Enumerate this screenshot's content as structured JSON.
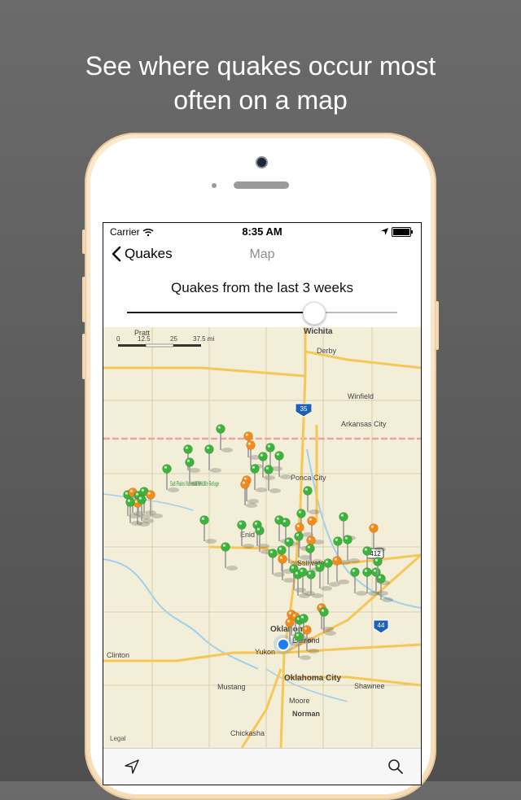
{
  "promo": {
    "headline_line1": "See where quakes occur most",
    "headline_line2": "often on a map"
  },
  "status_bar": {
    "carrier": "Carrier",
    "time": "8:35 AM"
  },
  "nav": {
    "back_label": "Quakes",
    "title": "Map"
  },
  "filter": {
    "label": "Quakes from the last 3 weeks",
    "slider_value_fraction": 0.69
  },
  "map": {
    "scale_labels": [
      "0",
      "12.5",
      "25",
      "37.5 mi"
    ],
    "legal": "Legal",
    "places": [
      {
        "name": "Wichita"
      },
      {
        "name": "Pratt"
      },
      {
        "name": "Derby"
      },
      {
        "name": "Winfield"
      },
      {
        "name": "Arkansas City"
      },
      {
        "name": "Ponca City"
      },
      {
        "name": "Salt Plains National Wildlife Refuge"
      },
      {
        "name": "Enid"
      },
      {
        "name": "Stillwater"
      },
      {
        "name": "Oklahoma"
      },
      {
        "name": "Edmond"
      },
      {
        "name": "Yukon"
      },
      {
        "name": "Oklahoma City"
      },
      {
        "name": "Clinton"
      },
      {
        "name": "Mustang"
      },
      {
        "name": "Moore"
      },
      {
        "name": "Norman"
      },
      {
        "name": "Shawnee"
      },
      {
        "name": "Chickasha"
      }
    ],
    "shields": [
      "35",
      "412",
      "44"
    ],
    "pin_colors": {
      "green": "#3db23d",
      "orange": "#f28a1c"
    }
  },
  "toolbar": {
    "location_icon": "location-arrow-icon",
    "search_icon": "search-icon"
  }
}
